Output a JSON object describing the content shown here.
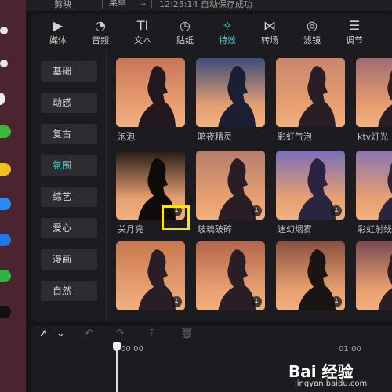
{
  "app": {
    "name": "剪映",
    "menu_label": "菜单",
    "save_status": "12:25:14 自动保存成功"
  },
  "tabs": [
    {
      "label": "媒体",
      "icon": "media-icon"
    },
    {
      "label": "音频",
      "icon": "audio-icon"
    },
    {
      "label": "文本",
      "icon": "text-icon",
      "glyph": "TI"
    },
    {
      "label": "贴纸",
      "icon": "sticker-icon"
    },
    {
      "label": "特效",
      "icon": "effects-icon",
      "active": true
    },
    {
      "label": "转场",
      "icon": "transition-icon"
    },
    {
      "label": "滤镜",
      "icon": "filter-icon"
    },
    {
      "label": "调节",
      "icon": "adjust-icon"
    }
  ],
  "categories": [
    {
      "label": "基础"
    },
    {
      "label": "动感"
    },
    {
      "label": "复古"
    },
    {
      "label": "氛围",
      "active": true
    },
    {
      "label": "综艺"
    },
    {
      "label": "爱心"
    },
    {
      "label": "漫画"
    },
    {
      "label": "自然"
    }
  ],
  "effects": [
    {
      "label": "泡泡",
      "bg": "#c8755a",
      "downloaded": true
    },
    {
      "label": "暗夜精灵",
      "bg": "#3d4d7a",
      "downloaded": true
    },
    {
      "label": "彩虹气泡",
      "bg": "#c9866e",
      "downloaded": true
    },
    {
      "label": "ktv灯光",
      "bg": "#a06a72",
      "downloaded": true
    },
    {
      "label": "关月亮",
      "bg": "#241c17",
      "downloaded": false,
      "highlighted": true
    },
    {
      "label": "玻璃破碎",
      "bg": "#b47d6c",
      "downloaded": false
    },
    {
      "label": "迷幻烟雾",
      "bg": "#7a6fb8",
      "downloaded": false
    },
    {
      "label": "彩虹射线",
      "bg": "#8a76b0",
      "downloaded": false
    },
    {
      "label": "",
      "bg": "#c87850",
      "downloaded": false
    },
    {
      "label": "",
      "bg": "#b3664c",
      "downloaded": false
    },
    {
      "label": "",
      "bg": "#8a5040",
      "downloaded": false
    },
    {
      "label": "",
      "bg": "#7a4a52",
      "downloaded": false
    }
  ],
  "timeline": {
    "time_start": "00:00",
    "time_mark": "01:00"
  },
  "watermark": {
    "text": "Bai 经验",
    "url": "jingyan.baidu.com"
  },
  "colors": {
    "accent": "#3ad4d0",
    "highlight": "#ffe600"
  }
}
